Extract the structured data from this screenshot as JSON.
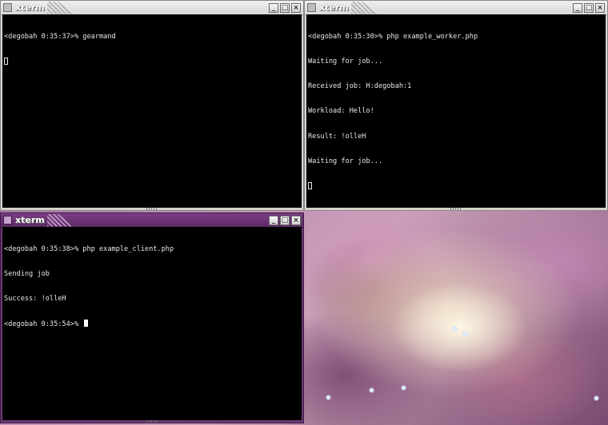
{
  "windows": {
    "top_left": {
      "title": "xterm",
      "lines": [
        "<degobah 0:35:37>% gearmand"
      ]
    },
    "top_right": {
      "title": "xterm",
      "lines": [
        "<degobah 0:35:30>% php example_worker.php",
        "Waiting for job...",
        "Received job: H:degobah:1",
        "Workload: Hello!",
        "Result: !olleH",
        "Waiting for job..."
      ]
    },
    "bottom_left": {
      "title": "xterm",
      "lines": [
        "<degobah 0:35:38>% php example_client.php",
        "Sending job",
        "Success: !olleH",
        "<degobah 0:35:54>% "
      ]
    }
  },
  "buttons": {
    "minimize": "_",
    "maximize": "□",
    "close": "×"
  },
  "desktop": {
    "wallpaper": "orion-nebula-image"
  }
}
